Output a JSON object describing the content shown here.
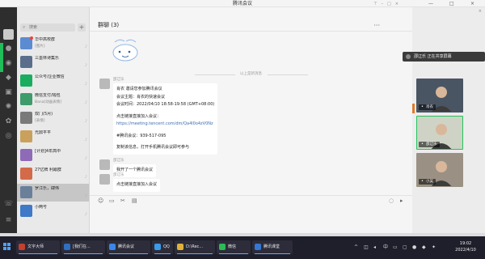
{
  "window": {
    "title": "腾讯会议",
    "controls": [
      "—",
      "□",
      "×"
    ]
  },
  "wechat": {
    "search": {
      "placeholder": "搜索",
      "add_label": "+"
    },
    "chats": [
      {
        "name": "华中高校群",
        "preview": "[图片]",
        "time": "",
        "color": "#5b8bd0",
        "unread": true
      },
      {
        "name": "三墨林诗集乐",
        "preview": "",
        "time": "",
        "color": "#5a6e8c",
        "unread": false
      },
      {
        "name": "公众号/企业微信",
        "preview": "",
        "time": "",
        "color": "#1aad5f",
        "unread": false
      },
      {
        "name": "微信支付/钱包",
        "preview": "Bana[动画表情]",
        "time": "",
        "color": "#3f9b6a",
        "unread": false
      },
      {
        "name": "双门(5月)",
        "preview": "[表情]",
        "time": "",
        "color": "#7a7a7a",
        "unread": false
      },
      {
        "name": "光鼎平平",
        "preview": "",
        "time": "",
        "color": "#c9a15c",
        "unread": false
      },
      {
        "name": "[计划]4年高中",
        "preview": "",
        "time": "",
        "color": "#8f6ab8",
        "unread": false
      },
      {
        "name": "27亿牌 利跟群",
        "preview": "",
        "time": "",
        "color": "#d36a4a",
        "unread": false
      },
      {
        "name": "罗江乐，肆伟",
        "preview": "",
        "time": "",
        "color": "#6a7f9a",
        "unread": false
      },
      {
        "name": "小两号",
        "preview": "",
        "time": "",
        "color": "#3f79c7",
        "unread": false
      }
    ],
    "nav_icons": [
      "chat-icon",
      "contacts-icon",
      "favorites-icon",
      "files-icon",
      "moments-icon",
      "miniprogram-icon",
      "phone-icon",
      "settings-icon"
    ]
  },
  "chat": {
    "title": "群聊 (3)",
    "more_label": "···",
    "time_separator": "以上是新消息",
    "messages": [
      {
        "sender": "邵辽乐",
        "lines": [
          {
            "text": "肖农 邀请您参加腾讯会议",
            "link": false
          },
          {
            "text": "会议主题：肖农的快速会议",
            "link": false
          },
          {
            "text": "会议时间：2022/04/10 18:58-19:58 (GMT+08:00)",
            "link": false
          },
          {
            "text": "",
            "link": false
          },
          {
            "text": "点击链接直接加入会议：",
            "link": false
          },
          {
            "text": "https://meeting.tencent.com/dm/Qa4l0o4zV0Nz",
            "link": true
          },
          {
            "text": "",
            "link": false
          },
          {
            "text": "#腾讯会议：939-517-095",
            "link": false
          },
          {
            "text": "",
            "link": false
          },
          {
            "text": "复制该信息，打开手机腾讯会议即可参与",
            "link": false
          }
        ]
      },
      {
        "sender": "邵辽乐",
        "lines": [
          {
            "text": "我开了一个腾讯会议",
            "link": false
          }
        ]
      },
      {
        "sender": "邵辽乐",
        "lines": [
          {
            "text": "点击链接直接加入会议",
            "link": false
          }
        ]
      }
    ],
    "toolbar_icons": [
      "emoji-icon",
      "folder-icon",
      "scissors-icon",
      "chat-history-icon",
      "call-icon",
      "video-icon"
    ]
  },
  "meeting": {
    "sharing_text": "邵辽乐 正在共享屏幕",
    "participants": [
      {
        "name": "肖农",
        "bg": "#4a5563",
        "speaking": false
      },
      {
        "name": "邵辽乐",
        "bg": "#cfd3c6",
        "speaking": true
      },
      {
        "name": "小吴",
        "bg": "#9a9184",
        "speaking": false
      }
    ]
  },
  "taskbar": {
    "items": [
      {
        "label": "文字大师",
        "color": "#c2402f"
      },
      {
        "label": "[我们在...",
        "color": "#2f6fc2"
      },
      {
        "label": "腾讯会议",
        "color": "#3a87e8"
      },
      {
        "label": "QQ",
        "color": "#3a9be8"
      },
      {
        "label": "D:\\Rec...",
        "color": "#e0b23a"
      },
      {
        "label": "微信",
        "color": "#2cbb56"
      },
      {
        "label": "腾讯课堂",
        "color": "#3478d4"
      }
    ],
    "clock": {
      "time": "19:02",
      "date": "2022/4/10"
    }
  }
}
